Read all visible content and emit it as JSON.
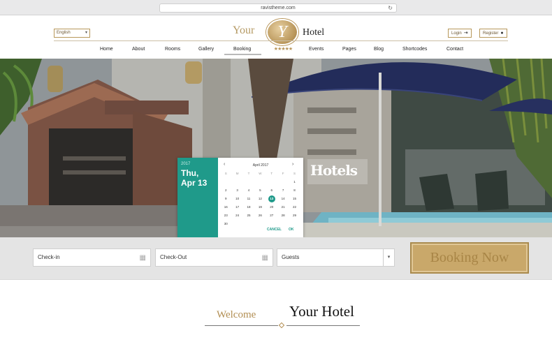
{
  "browser": {
    "url": "ravistheme.com"
  },
  "header": {
    "language": "English",
    "brand_left": "Your",
    "brand_right": "Hotel",
    "logo_letter": "Y",
    "stars": "★★★★★",
    "login": "Login",
    "register": "Register"
  },
  "nav": [
    "Home",
    "About",
    "Rooms",
    "Gallery",
    "Booking",
    "Events",
    "Pages",
    "Blog",
    "Shortcodes",
    "Contact"
  ],
  "hero": {
    "label": "Hotels"
  },
  "datepicker": {
    "year": "2017",
    "date_line1": "Thu,",
    "date_line2": "Apr 13",
    "month": "April 2017",
    "weekdays": [
      "S",
      "M",
      "T",
      "W",
      "T",
      "F",
      "S"
    ],
    "weeks": [
      [
        "",
        "",
        "",
        "",
        "",
        "",
        "1"
      ],
      [
        "2",
        "3",
        "4",
        "5",
        "6",
        "7",
        "8"
      ],
      [
        "9",
        "10",
        "11",
        "12",
        "13",
        "14",
        "15"
      ],
      [
        "16",
        "17",
        "18",
        "19",
        "20",
        "21",
        "22"
      ],
      [
        "23",
        "24",
        "25",
        "26",
        "27",
        "28",
        "29"
      ],
      [
        "30",
        "",
        "",
        "",
        "",
        "",
        ""
      ]
    ],
    "selected": "13",
    "cancel": "CANCEL",
    "ok": "OK"
  },
  "booking": {
    "checkin": "Check-in",
    "checkout": "Check-Out",
    "guests": "Guests",
    "button": "Booking Now"
  },
  "welcome": {
    "word": "Welcome",
    "name": "Your Hotel"
  },
  "colors": {
    "teal": "#1f9a8a",
    "gold": "#b89559"
  }
}
